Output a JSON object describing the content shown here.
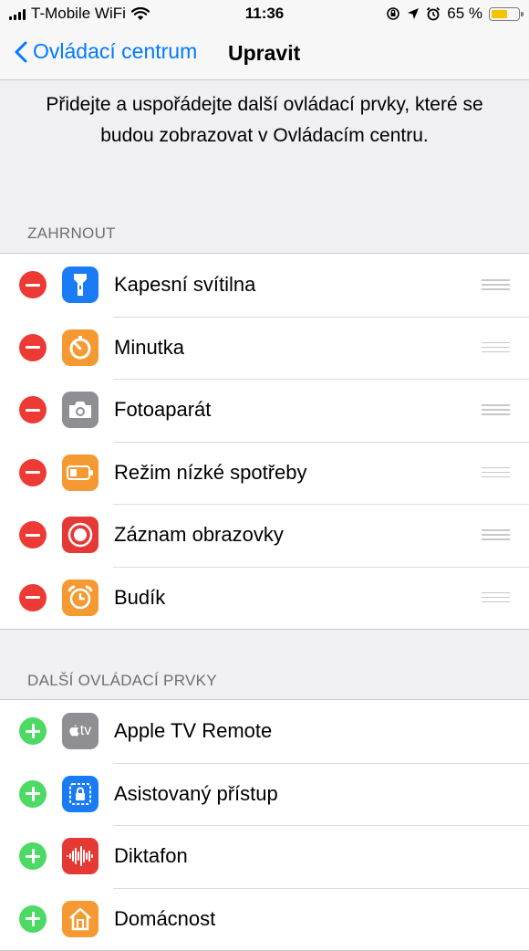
{
  "status_bar": {
    "carrier": "T-Mobile WiFi",
    "time": "11:36",
    "battery_percent": "65 %",
    "battery_level": 0.65,
    "icons": [
      "signal-icon",
      "wifi-icon",
      "orientation-lock-icon",
      "location-icon",
      "alarm-icon",
      "battery-icon"
    ]
  },
  "nav": {
    "back_label": "Ovládací centrum",
    "title": "Upravit"
  },
  "intro_text": "Přidejte a uspořádejte další ovládací prvky, které se budou zobrazovat v Ovládacím centru.",
  "included": {
    "header": "ZAHRNOUT",
    "items": [
      {
        "label": "Kapesní svítilna",
        "icon": "flashlight-icon",
        "color": "#1a7cf5"
      },
      {
        "label": "Minutka",
        "icon": "timer-icon",
        "color": "#f59a32"
      },
      {
        "label": "Fotoaparát",
        "icon": "camera-icon",
        "color": "#8e8e93"
      },
      {
        "label": "Režim nízké spotřeby",
        "icon": "battery-low-power-icon",
        "color": "#f59a32"
      },
      {
        "label": "Záznam obrazovky",
        "icon": "screen-record-icon",
        "color": "#e53935"
      },
      {
        "label": "Budík",
        "icon": "alarm-clock-icon",
        "color": "#f59a32"
      }
    ]
  },
  "more": {
    "header": "DALŠÍ OVLÁDACÍ PRVKY",
    "items": [
      {
        "label": "Apple TV Remote",
        "icon": "apple-tv-icon",
        "color": "#8e8e93",
        "icon_text": "tv"
      },
      {
        "label": "Asistovaný přístup",
        "icon": "guided-access-icon",
        "color": "#1a7cf5"
      },
      {
        "label": "Diktafon",
        "icon": "voice-memos-icon",
        "color": "#e53935"
      },
      {
        "label": "Domácnost",
        "icon": "home-icon",
        "color": "#f59a32"
      }
    ]
  }
}
